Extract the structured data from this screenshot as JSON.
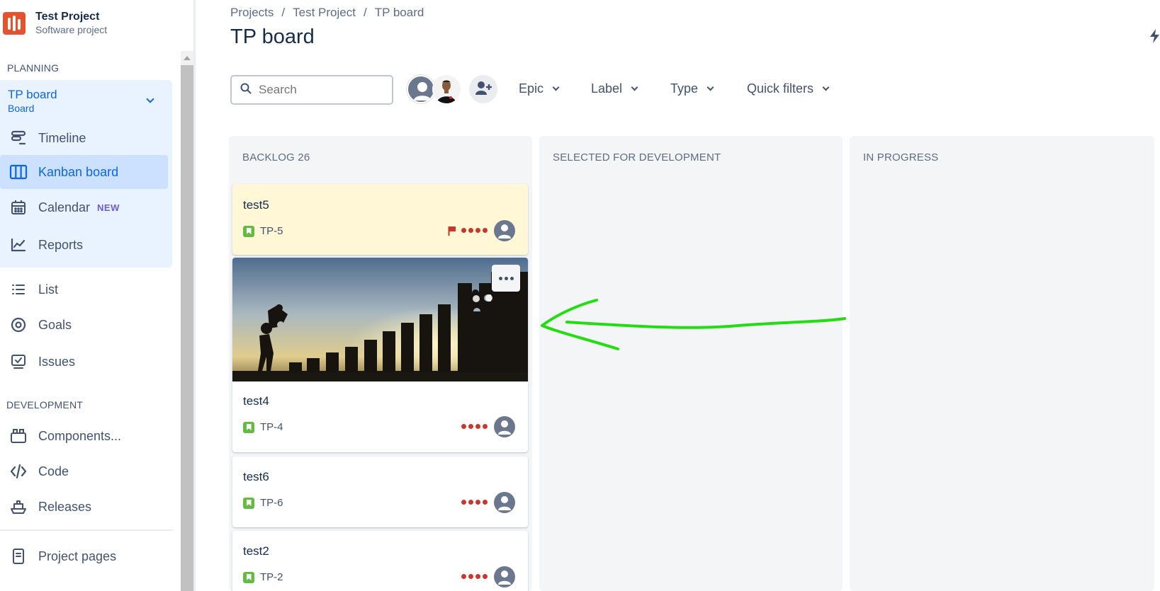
{
  "project": {
    "name": "Test Project",
    "type": "Software project"
  },
  "sidebar": {
    "planning_label": "PLANNING",
    "board": {
      "name": "TP board",
      "subtitle": "Board"
    },
    "planning_items": [
      {
        "label": "Timeline",
        "icon": "timeline-icon"
      },
      {
        "label": "Kanban board",
        "icon": "kanban-board-icon",
        "active": true
      },
      {
        "label": "Calendar",
        "icon": "calendar-icon",
        "badge": "NEW"
      },
      {
        "label": "Reports",
        "icon": "reports-icon"
      }
    ],
    "other_items": [
      {
        "label": "List",
        "icon": "list-icon"
      },
      {
        "label": "Goals",
        "icon": "goals-icon"
      },
      {
        "label": "Issues",
        "icon": "issues-icon"
      }
    ],
    "development_label": "DEVELOPMENT",
    "development_items": [
      {
        "label": "Components...",
        "icon": "components-icon"
      },
      {
        "label": "Code",
        "icon": "code-icon"
      },
      {
        "label": "Releases",
        "icon": "releases-icon"
      }
    ],
    "project_pages": {
      "label": "Project pages",
      "icon": "project-pages-icon"
    }
  },
  "breadcrumb": [
    "Projects",
    "Test Project",
    "TP board"
  ],
  "breadcrumb_separator": "/",
  "page_title": "TP board",
  "toolbar": {
    "search_placeholder": "Search",
    "filters": [
      "Epic",
      "Label",
      "Type",
      "Quick filters"
    ]
  },
  "columns": [
    {
      "title": "BACKLOG 26"
    },
    {
      "title": "SELECTED FOR DEVELOPMENT"
    },
    {
      "title": "IN PROGRESS"
    }
  ],
  "cards": [
    {
      "summary": "test5",
      "key": "TP-5",
      "flagged": true,
      "priority": "highest"
    },
    {
      "summary": "test4",
      "key": "TP-4",
      "has_cover": true,
      "priority": "highest"
    },
    {
      "summary": "test6",
      "key": "TP-6",
      "priority": "highest"
    },
    {
      "summary": "test2",
      "key": "TP-2",
      "priority": "highest"
    }
  ],
  "colors": {
    "accent": "#0c66e4",
    "selection_bg": "#e9f2ff",
    "flagged_card_bg": "#fff7d6",
    "priority_dots": "#c9372c",
    "story_icon": "#65ba43",
    "annotation_arrow": "#22dd11"
  }
}
